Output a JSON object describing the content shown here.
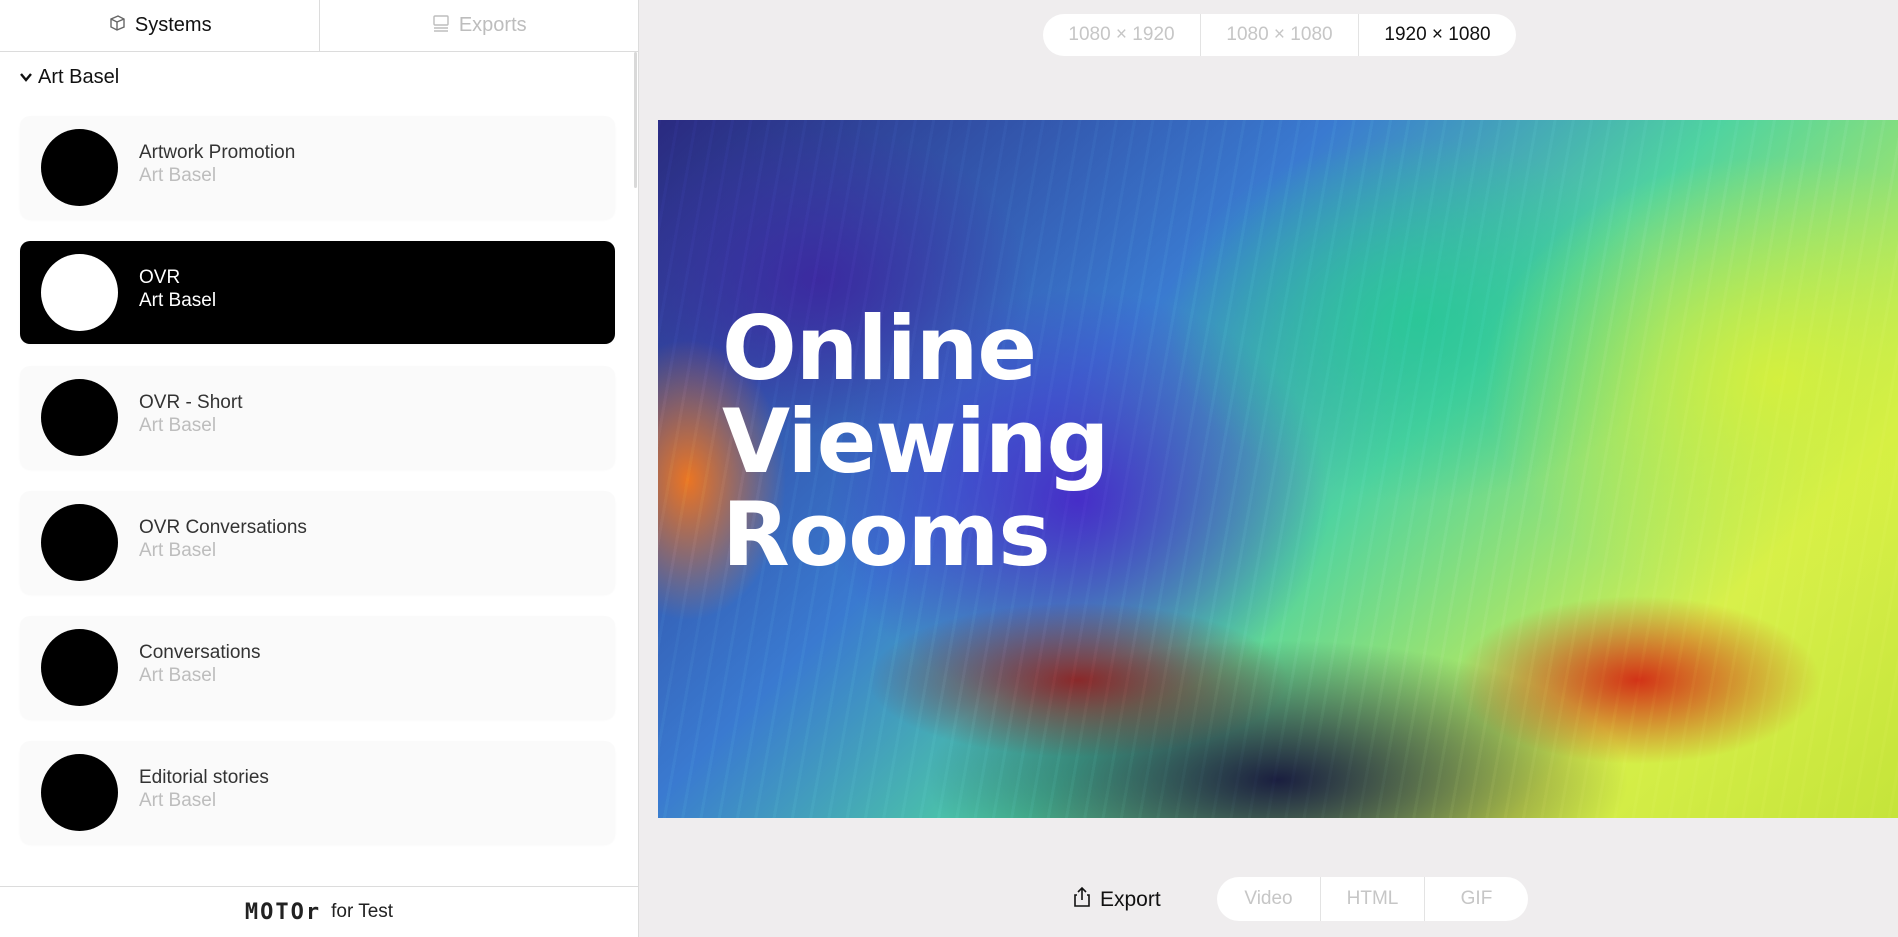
{
  "tabs": [
    {
      "label": "Systems",
      "icon": "cube-icon",
      "active": true
    },
    {
      "label": "Exports",
      "icon": "stack-icon",
      "active": false
    }
  ],
  "group": {
    "label": "Art Basel",
    "icon": "chevron-down-icon",
    "expanded": true
  },
  "systems": [
    {
      "name": "Artwork Promotion",
      "org": "Art Basel",
      "selected": false
    },
    {
      "name": "OVR",
      "org": "Art Basel",
      "selected": true
    },
    {
      "name": "OVR - Short",
      "org": "Art Basel",
      "selected": false
    },
    {
      "name": "OVR Conversations",
      "org": "Art Basel",
      "selected": false
    },
    {
      "name": "Conversations",
      "org": "Art Basel",
      "selected": false
    },
    {
      "name": "Editorial stories",
      "org": "Art Basel",
      "selected": false
    }
  ],
  "footer": {
    "brand": "MOTOr",
    "tenant": "for Test"
  },
  "sizes": [
    {
      "label": "1080 × 1920",
      "active": false
    },
    {
      "label": "1080 × 1080",
      "active": false
    },
    {
      "label": "1920 × 1080",
      "active": true
    }
  ],
  "preview": {
    "lines": [
      "Online",
      "Viewing",
      "Rooms"
    ]
  },
  "export": {
    "label": "Export",
    "icon": "share-icon"
  },
  "formats": [
    {
      "label": "Video",
      "active": false
    },
    {
      "label": "HTML",
      "active": false
    },
    {
      "label": "GIF",
      "active": false
    }
  ],
  "colors": {
    "selected_card": "#000000",
    "muted_text": "#bdbdbd",
    "canvas_bg": "#efedee"
  }
}
